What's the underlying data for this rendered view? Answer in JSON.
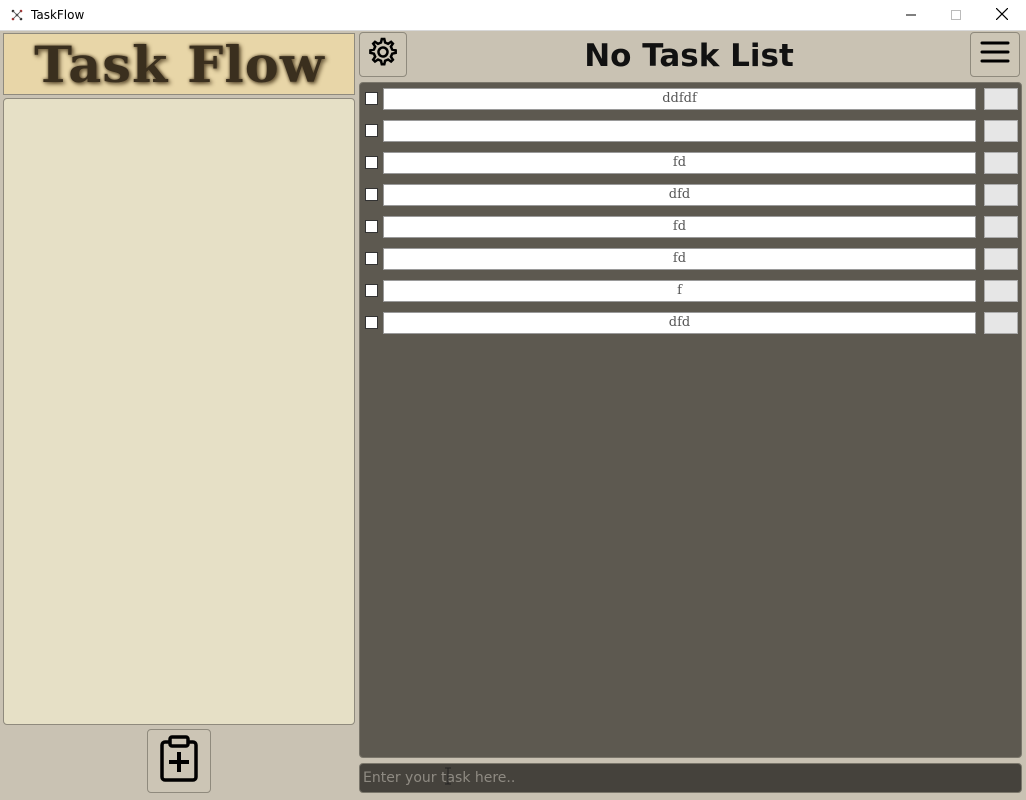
{
  "window": {
    "title": "TaskFlow",
    "app_icon": "taskflow-app-icon",
    "controls": [
      "minimize-icon",
      "maximize-icon",
      "close-icon"
    ]
  },
  "sidebar": {
    "logo_text": "Task Flow",
    "task_lists": [],
    "add_list_icon": "clipboard-plus-icon"
  },
  "header": {
    "settings_icon": "gear-icon",
    "title": "No Task List",
    "menu_icon": "hamburger-menu-icon"
  },
  "tasks": [
    {
      "text": "ddfdf",
      "checked": false
    },
    {
      "text": "",
      "checked": false
    },
    {
      "text": "fd",
      "checked": false
    },
    {
      "text": "dfd",
      "checked": false
    },
    {
      "text": "fd",
      "checked": false
    },
    {
      "text": "fd",
      "checked": false
    },
    {
      "text": "f",
      "checked": false
    },
    {
      "text": "dfd",
      "checked": false
    }
  ],
  "task_input": {
    "value": "",
    "placeholder": "Enter your task here.."
  },
  "colors": {
    "background": "#c9c2b3",
    "logo_bg": "#e8d6a8",
    "list_panel_bg": "#e6e0c6",
    "task_area_bg": "#5d5950",
    "input_bg": "#45423c"
  }
}
